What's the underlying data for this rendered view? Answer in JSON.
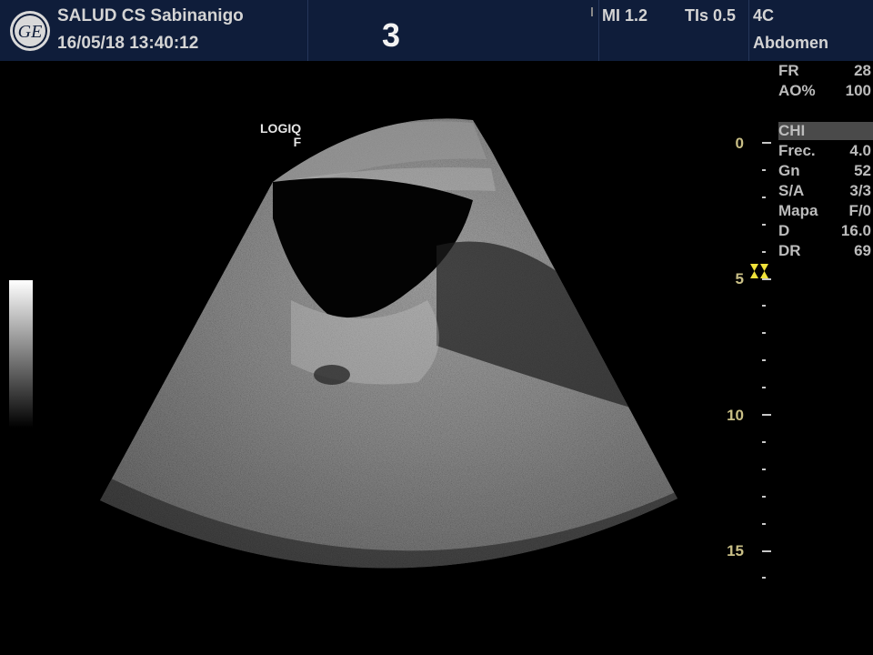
{
  "header": {
    "institution": "SALUD  CS Sabinanigo",
    "datetime": "16/05/18 13:40:12",
    "image_number": "3",
    "mi": "MI 1.2",
    "tis": "TIs 0.5",
    "probe": "4C",
    "preset": "Abdomen",
    "logo_icon": "ge-logo-icon"
  },
  "top_params": [
    {
      "key": "FR",
      "value": "28"
    },
    {
      "key": "AO%",
      "value": "100"
    }
  ],
  "mode_label": "CHI",
  "image_params": [
    {
      "key": "Frec.",
      "value": "4.0"
    },
    {
      "key": "Gn",
      "value": "52"
    },
    {
      "key": "S/A",
      "value": "3/3"
    },
    {
      "key": "Mapa",
      "value": "F/0"
    },
    {
      "key": "D",
      "value": "16.0"
    },
    {
      "key": "DR",
      "value": "69"
    }
  ],
  "depth_scale": {
    "labels": [
      "0",
      "5",
      "10",
      "15"
    ],
    "unit_max": 16
  },
  "image_labels": {
    "line1": "LOGIQ",
    "line2": "F"
  },
  "colors": {
    "header_bg": "#0f1d3a",
    "depth_label": "#c9bf86",
    "focus_marker": "#f0e23a"
  }
}
